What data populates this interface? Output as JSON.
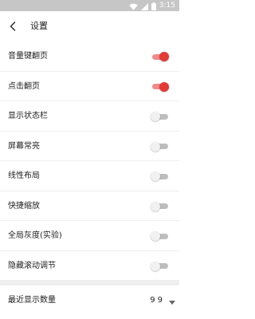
{
  "status_bar": {
    "time": "3:15",
    "icons": [
      "wifi-icon",
      "signal-icon",
      "battery-icon"
    ]
  },
  "header": {
    "title": "设置",
    "back_icon": "chevron-left-icon"
  },
  "settings": [
    {
      "label": "音量键翻页",
      "enabled": true
    },
    {
      "label": "点击翻页",
      "enabled": true
    },
    {
      "label": "显示状态栏",
      "enabled": false
    },
    {
      "label": "屏幕常亮",
      "enabled": false
    },
    {
      "label": "线性布局",
      "enabled": false
    },
    {
      "label": "快捷缩放",
      "enabled": false
    },
    {
      "label": "全局灰度(实验)",
      "enabled": false
    },
    {
      "label": "隐藏滚动调节",
      "enabled": false
    }
  ],
  "recent_display": {
    "label": "最近显示数量",
    "value": "99",
    "dropdown_icon": "triangle-down-icon"
  },
  "colors": {
    "accent": "#e53935",
    "accent_track": "#f08a8a",
    "status_bar": "#c6c6c6"
  }
}
